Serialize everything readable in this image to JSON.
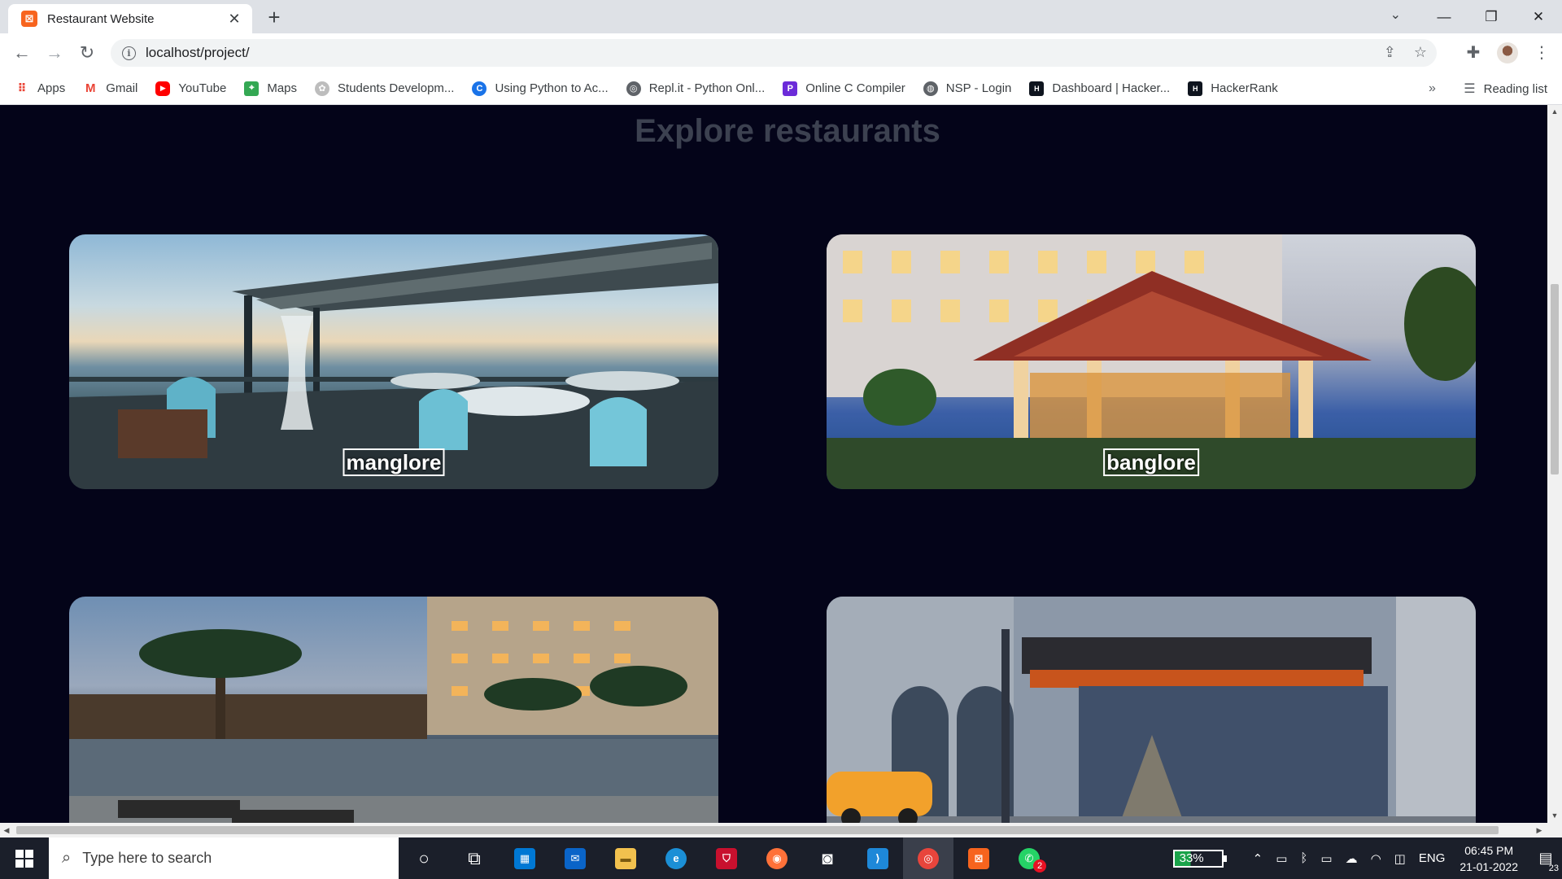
{
  "browser": {
    "tab_title": "Restaurant Website",
    "tab_favicon": "xampp-icon",
    "url": "localhost/project/",
    "reading_list": "Reading list",
    "more_bookmarks": "»"
  },
  "bookmarks": [
    {
      "label": "Apps",
      "icon": "apps-grid-icon",
      "color": "#ea4335"
    },
    {
      "label": "Gmail",
      "icon": "gmail-icon",
      "color": "#ea4335"
    },
    {
      "label": "YouTube",
      "icon": "youtube-icon",
      "color": "#ff0000"
    },
    {
      "label": "Maps",
      "icon": "maps-icon",
      "color": "#34a853"
    },
    {
      "label": "Students Developm...",
      "icon": "students-icon",
      "color": "#9e9e9e"
    },
    {
      "label": "Using Python to Ac...",
      "icon": "coursera-icon",
      "color": "#1a73e8"
    },
    {
      "label": "Repl.it - Python Onl...",
      "icon": "replit-icon",
      "color": "#5f6368"
    },
    {
      "label": "Online C Compiler",
      "icon": "programiz-icon",
      "color": "#6c2bd9"
    },
    {
      "label": "NSP - Login",
      "icon": "globe-icon",
      "color": "#5f6368"
    },
    {
      "label": "Dashboard | Hacker...",
      "icon": "hackerrank-icon",
      "color": "#0e141e"
    },
    {
      "label": "HackerRank",
      "icon": "hackerrank-icon",
      "color": "#0e141e"
    }
  ],
  "page": {
    "heading": "Explore restaurants",
    "cards": [
      {
        "city": "manglore"
      },
      {
        "city": "banglore"
      }
    ]
  },
  "taskbar": {
    "search_placeholder": "Type here to search",
    "battery": "33%",
    "language": "ENG",
    "time": "06:45 PM",
    "date": "21-01-2022",
    "whatsapp_badge": "2",
    "notifications": "23"
  },
  "colors": {
    "page_bg": "#040419",
    "heading": "#3c4150",
    "accent": "#f7641e"
  }
}
